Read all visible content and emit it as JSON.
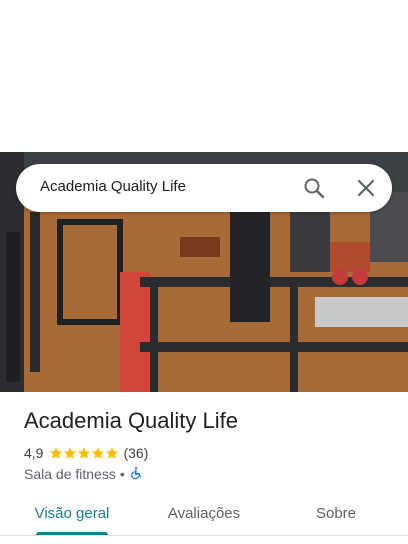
{
  "search": {
    "query": "Academia Quality Life",
    "search_icon": "search-icon",
    "close_icon": "close-icon"
  },
  "place": {
    "name": "Academia Quality Life",
    "rating": "4,9",
    "stars": 5,
    "review_count": "(36)",
    "category": "Sala de fitness",
    "separator": "•",
    "accessibility_icon": "wheelchair-accessible-icon"
  },
  "tabs": [
    {
      "label": "Visão geral",
      "active": true
    },
    {
      "label": "Avaliações",
      "active": false
    },
    {
      "label": "Sobre",
      "active": false
    }
  ],
  "colors": {
    "accent": "#1a7f8a",
    "star": "#fbbc04",
    "accessibility": "#1a73e8"
  }
}
